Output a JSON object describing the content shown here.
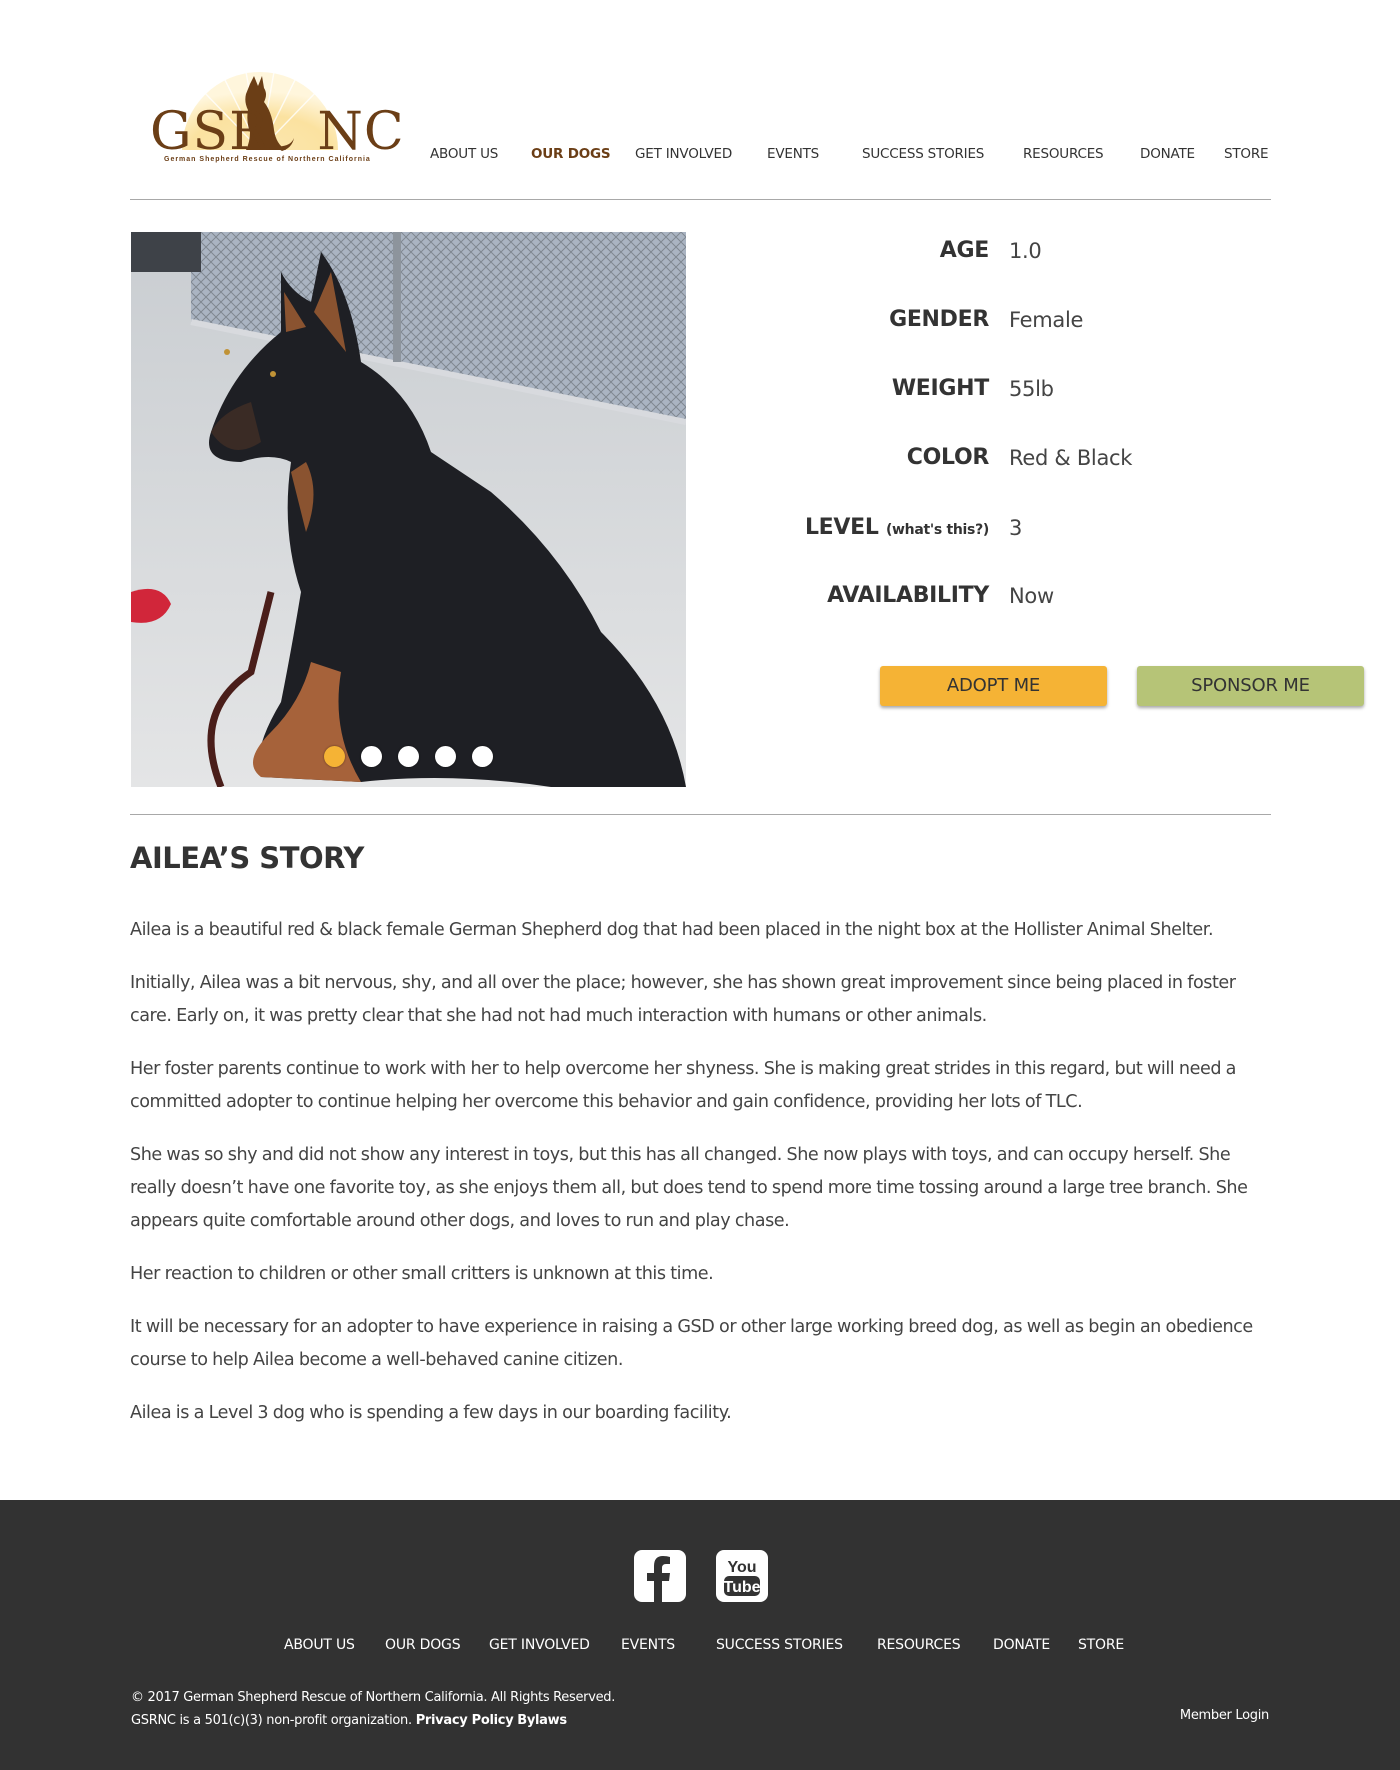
{
  "header": {
    "logo_text": "GSR NC",
    "logo_tagline": "German Shepherd Rescue of Northern California",
    "nav": [
      {
        "label": "ABOUT US",
        "active": false
      },
      {
        "label": "OUR DOGS",
        "active": true
      },
      {
        "label": "GET INVOLVED",
        "active": false
      },
      {
        "label": "EVENTS",
        "active": false
      },
      {
        "label": "SUCCESS STORIES",
        "active": false
      },
      {
        "label": "RESOURCES",
        "active": false
      },
      {
        "label": "DONATE",
        "active": false
      },
      {
        "label": "STORE",
        "active": false
      }
    ]
  },
  "dog": {
    "photo_slides": 5,
    "active_slide": 1,
    "facts": {
      "age": {
        "label": "AGE",
        "value": "1.0"
      },
      "gender": {
        "label": "GENDER",
        "value": "Female"
      },
      "weight": {
        "label": "WEIGHT",
        "value": "55lb"
      },
      "color": {
        "label": "COLOR",
        "value": "Red & Black"
      },
      "level": {
        "label": "LEVEL",
        "help_link": "(what's this?)",
        "value": "3"
      },
      "availability": {
        "label": "AVAILABILITY",
        "value": "Now"
      }
    },
    "adopt_button": "ADOPT ME",
    "sponsor_button": "SPONSOR ME"
  },
  "story": {
    "title": "AILEA’S STORY",
    "paragraphs": [
      "Ailea is a beautiful red & black female German Shepherd dog that had been placed in the night box at the Hollister Animal Shelter.",
      "Initially, Ailea was a bit nervous, shy, and all over the place; however, she has shown great improvement since being placed in foster care. Early on, it was pretty clear that she had not had much interaction with humans or other animals.",
      "Her foster parents continue to work with her to help overcome her shyness. She is making great strides in this regard, but will need a committed adopter to continue helping her overcome this behavior and gain confidence, providing her lots of TLC.",
      "She was so shy and did not show any interest in toys, but this has all changed. She now plays with toys, and can occupy herself. She really doesn’t have one favorite toy, as she enjoys them all, but does tend to spend more time tossing around a large tree branch. She appears quite comfortable around other dogs, and loves to run and play chase.",
      "Her reaction to children or other small critters is unknown at this time.",
      "It will be necessary for an adopter to have experience in raising a GSD or other large working breed dog, as well as begin an obedience course to help Ailea become a well-behaved canine citizen.",
      "Ailea is a Level 3 dog who is spending a few days in our boarding facility."
    ]
  },
  "footer": {
    "social": [
      {
        "icon": "facebook-icon",
        "label": "f"
      },
      {
        "icon": "youtube-icon",
        "label_top": "You",
        "label_bottom": "Tube"
      }
    ],
    "nav": [
      "ABOUT US",
      "OUR DOGS",
      "GET INVOLVED",
      "EVENTS",
      "SUCCESS STORIES",
      "RESOURCES",
      "DONATE",
      "STORE"
    ],
    "copyright": "© 2017 German Shepherd Rescue of Northern California. All Rights Reserved.",
    "nonprofit": "GSRNC is a 501(c)(3) non-profit organization.",
    "privacy_link": "Privacy Policy",
    "bylaws_link": "Bylaws",
    "member_login": "Member Login"
  },
  "colors": {
    "brand_brown": "#6b3e16",
    "adopt_orange": "#f5b335",
    "sponsor_green": "#b6c477",
    "footer_bg": "#323232"
  }
}
